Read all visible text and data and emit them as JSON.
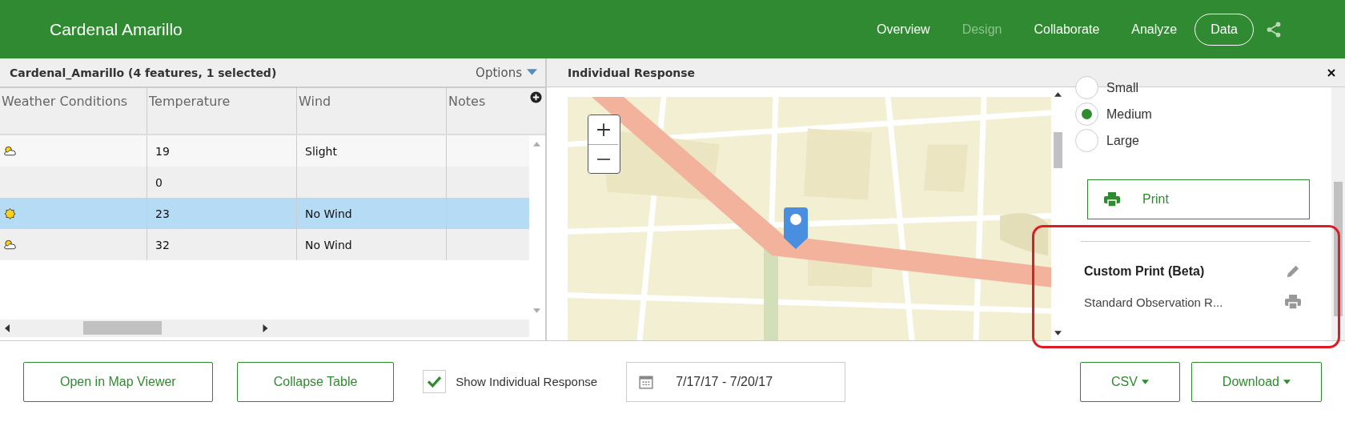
{
  "header": {
    "title": "Cardenal Amarillo",
    "nav": [
      {
        "label": "Overview",
        "disabled": false,
        "selected": false
      },
      {
        "label": "Design",
        "disabled": true,
        "selected": false
      },
      {
        "label": "Collaborate",
        "disabled": false,
        "selected": false
      },
      {
        "label": "Analyze",
        "disabled": false,
        "selected": false
      },
      {
        "label": "Data",
        "disabled": false,
        "selected": true
      }
    ]
  },
  "table_panel": {
    "title": "Cardenal_Amarillo (4 features, 1 selected)",
    "options": "Options",
    "columns": [
      "Weather Conditions",
      "Temperature",
      "Wind",
      "Notes"
    ],
    "rows": [
      {
        "kind": "partly-cloudy",
        "temperature": "19",
        "wind": "Slight",
        "selected": false
      },
      {
        "kind": "blank",
        "temperature": "0",
        "selected": false
      },
      {
        "kind": "sunny",
        "temperature": "23",
        "wind": "No Wind",
        "selected": true
      },
      {
        "kind": "partly-cloudy",
        "temperature": "32",
        "wind": "No Wind",
        "selected": false
      }
    ]
  },
  "response_panel": {
    "title": "Individual Response",
    "sizes": [
      {
        "label": "Small",
        "selected": false
      },
      {
        "label": "Medium",
        "selected": true
      },
      {
        "label": "Large",
        "selected": false
      }
    ],
    "print_button": "Print",
    "custom_print": {
      "title": "Custom Print (Beta)",
      "template": "Standard Observation R..."
    }
  },
  "footer": {
    "buttons": [
      "Open in Map Viewer",
      "Collapse Table"
    ],
    "show_individual": {
      "label": "Show Individual Response",
      "checked": true
    },
    "date_range": "7/17/17 - 7/20/17",
    "export_buttons": [
      "CSV",
      "Download"
    ]
  }
}
